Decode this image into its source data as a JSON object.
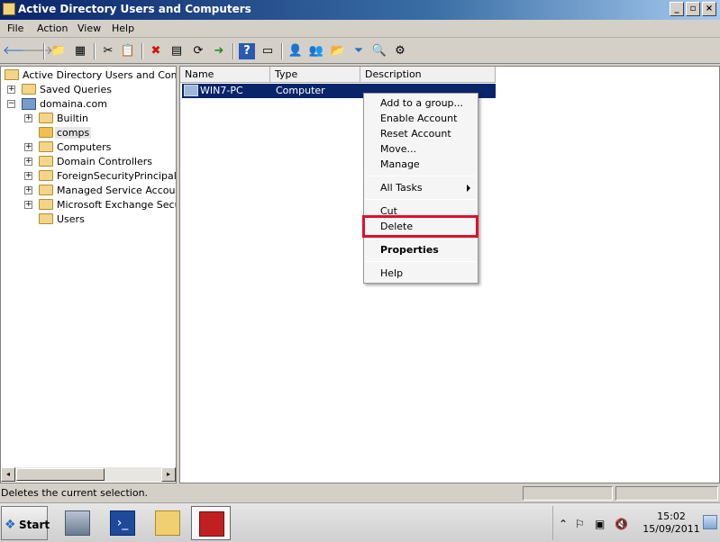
{
  "window": {
    "title": "Active Directory Users and Computers",
    "buttons": [
      "_",
      "▫",
      "×"
    ]
  },
  "menu": {
    "items": [
      "File",
      "Action",
      "View",
      "Help"
    ]
  },
  "toolbar": {
    "icons": [
      "back-arrow-icon",
      "forward-arrow-icon",
      "up-folder-icon",
      "show-hide-tree-icon",
      "cut-icon",
      "copy-icon",
      "delete-icon",
      "properties-icon",
      "refresh-icon",
      "export-list-icon",
      "help-icon",
      "view-icon",
      "new-user-icon",
      "new-group-icon",
      "new-ou-icon",
      "filter-icon",
      "find-icon",
      "add-to-group-icon"
    ],
    "glyphs": [
      "🡐",
      "🡒",
      "📁",
      "▦",
      "✂",
      "📋",
      "✖",
      "▤",
      "⟳",
      "➜",
      "?",
      "▭",
      "👤",
      "👥",
      "📂",
      "⏷",
      "🔍",
      "⚙"
    ]
  },
  "tree": {
    "root": "Active Directory Users and Comput",
    "items": [
      {
        "label": "Saved Queries",
        "expander": "+"
      },
      {
        "label": "domaina.com",
        "expander": "−"
      },
      {
        "label": "Builtin",
        "expander": "+"
      },
      {
        "label": "comps",
        "expander": ""
      },
      {
        "label": "Computers",
        "expander": "+"
      },
      {
        "label": "Domain Controllers",
        "expander": "+"
      },
      {
        "label": "ForeignSecurityPrincipals",
        "expander": "+"
      },
      {
        "label": "Managed Service Accounts",
        "expander": "+"
      },
      {
        "label": "Microsoft Exchange Securit",
        "expander": "+"
      },
      {
        "label": "Users",
        "expander": ""
      }
    ],
    "scroll_left": "◂",
    "scroll_right": "▸"
  },
  "list": {
    "columns": [
      "Name",
      "Type",
      "Description"
    ],
    "rows": [
      {
        "name": "WIN7-PC",
        "type": "Computer",
        "description": ""
      }
    ]
  },
  "context_menu": {
    "group1": [
      "Add to a group...",
      "Enable Account",
      "Reset Account",
      "Move...",
      "Manage"
    ],
    "all_tasks": "All Tasks",
    "cut": "Cut",
    "delete": "Delete",
    "properties": "Properties",
    "help": "Help",
    "highlight_color": "#e0102a"
  },
  "status": {
    "text": "Deletes the current selection."
  },
  "taskbar": {
    "start": "Start",
    "start_logo": "❖",
    "clock": {
      "time": "15:02",
      "date": "15/09/2011"
    },
    "tray_glyphs": [
      "⌃",
      "⚐",
      "▣",
      "🔇"
    ]
  }
}
